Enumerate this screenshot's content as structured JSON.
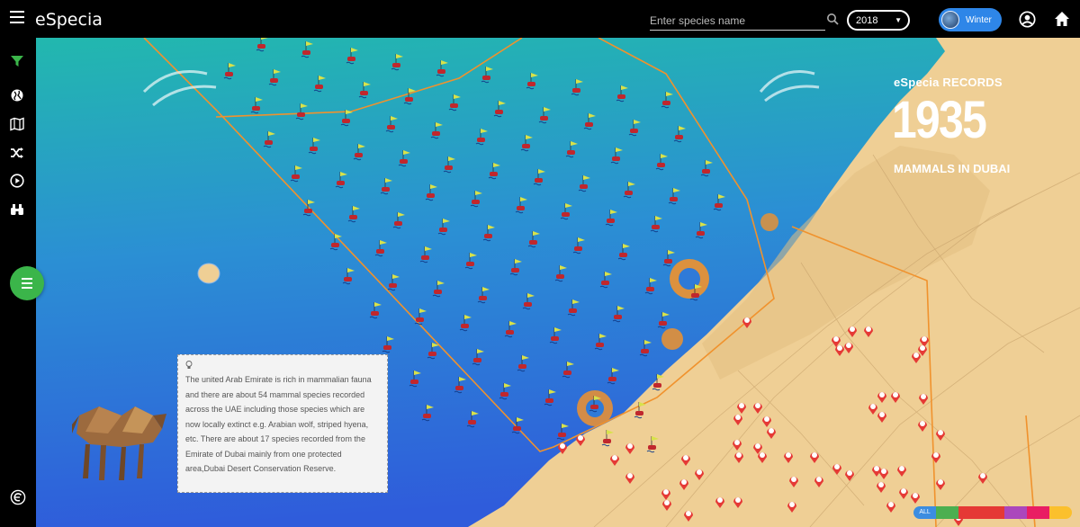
{
  "header": {
    "app_title": "eSpecia",
    "search_placeholder": "Enter species name",
    "year": "2018",
    "season": "Winter"
  },
  "records": {
    "label": "eSpecia RECORDS",
    "count": "1935",
    "subtitle": "MAMMALS IN DUBAI"
  },
  "info": {
    "text": "The united Arab Emirate is rich in mammalian fauna and there are about 54 mammal species recorded across the UAE including those species which are now locally extinct e.g. Arabian wolf, striped hyena, etc. There are about 17 species recorded from the Emirate of Dubai mainly from one protected area,Dubai Desert Conservation Reserve."
  },
  "legend": {
    "all_label": "ALL",
    "colors": [
      "#3c8de0",
      "#4caf50",
      "#e53935",
      "#e53935",
      "#ab47bc",
      "#e91e63",
      "#fbc02d"
    ]
  },
  "colors": {
    "sea_top": "#21b6b0",
    "sea_bottom": "#2e63d8",
    "land": "#efcf95",
    "accent_orange": "#f0922d",
    "fab_green": "#3bb54a"
  }
}
